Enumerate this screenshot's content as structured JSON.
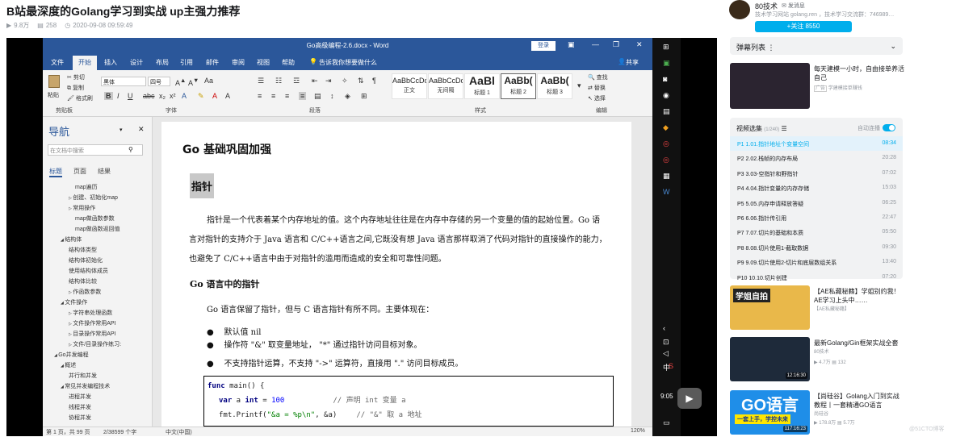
{
  "video": {
    "title": "B站最深度的Golang学习到实战 up主强力推荐",
    "views": "9.8万",
    "danmaku": "258",
    "date": "2020-09-08 09:59:49"
  },
  "word": {
    "window_title": "Go高级编程-2.6.docx - Word",
    "login": "登录",
    "tabs": [
      "文件",
      "开始",
      "插入",
      "设计",
      "布局",
      "引用",
      "邮件",
      "审阅",
      "视图",
      "帮助"
    ],
    "tell_me": "告诉我你想要做什么",
    "share": "共享",
    "ribbon": {
      "paste": "粘贴",
      "cut": "剪切",
      "copy": "复制",
      "format_painter": "格式刷",
      "clipboard": "剪贴板",
      "font_name": "黑体",
      "font_size": "四号",
      "font_group": "字体",
      "paragraph_group": "段落",
      "styles_group": "样式",
      "edit_group": "编辑",
      "find": "查找",
      "replace": "替换",
      "select": "选择",
      "styles": [
        {
          "preview": "AaBbCcDc",
          "name": "正文"
        },
        {
          "preview": "AaBbCcDc",
          "name": "无间隔"
        },
        {
          "preview": "AaBl",
          "name": "标题 1"
        },
        {
          "preview": "AaBb(",
          "name": "标题 2"
        },
        {
          "preview": "AaBb(",
          "name": "标题 3"
        }
      ]
    },
    "nav": {
      "title": "导航",
      "search_placeholder": "在文档中搜索",
      "tabs": [
        "标题",
        "页面",
        "结果"
      ],
      "items": [
        {
          "text": "map遍历",
          "level": 3
        },
        {
          "text": "创建、初始化map",
          "level": 2
        },
        {
          "text": "常用操作",
          "level": 2
        },
        {
          "text": "map做函数参数",
          "level": 3
        },
        {
          "text": "map做函数返回值",
          "level": 3
        },
        {
          "text": "结构体",
          "level": 1
        },
        {
          "text": "结构体类型",
          "level": 2
        },
        {
          "text": "结构体初始化",
          "level": 2
        },
        {
          "text": "使用结构体成员",
          "level": 2
        },
        {
          "text": "结构体比较",
          "level": 2
        },
        {
          "text": "作函数参数",
          "level": 2
        },
        {
          "text": "文件操作",
          "level": 1
        },
        {
          "text": "字符串处理函数",
          "level": 2
        },
        {
          "text": "文件操作常用API",
          "level": 2
        },
        {
          "text": "目录操作常用API",
          "level": 2
        },
        {
          "text": "文件/目录操作练习:",
          "level": 2
        },
        {
          "text": "Go并发编程",
          "level": 0
        },
        {
          "text": "概述",
          "level": 1
        },
        {
          "text": "并行和并发",
          "level": 2
        },
        {
          "text": "常见并发编程技术",
          "level": 1
        },
        {
          "text": "进程并发",
          "level": 2
        },
        {
          "text": "线程并发",
          "level": 2
        },
        {
          "text": "协程并发",
          "level": 2
        }
      ]
    },
    "doc": {
      "h1": "Go 基础巩固加强",
      "h2": "指针",
      "p1": "指针是一个代表着某个内存地址的值。这个内存地址往往是在内存中存储的另一个变量的值的起始位置。Go 语",
      "p2": "言对指针的支持介于 Java 语言和 C/C++语言之间,它既没有想 Java 语言那样取消了代码对指针的直接操作的能力，",
      "p3": "也避免了 C/C++语言中由于对指针的滥用而造成的安全和可靠性问题。",
      "h3": "Go 语言中的指针",
      "p4": "Go 语言保留了指针，但与 C 语言指针有所不同。主要体现在：",
      "bullets": [
        "默认值 nil",
        "操作符 \"&\" 取变量地址， \"*\" 通过指针访问目标对象。",
        "不支持指针运算，不支持 \"->\" 运算符，直接用 \".\" 访问目标成员。"
      ],
      "code": {
        "line1_kw": "func",
        "line1_rest": " main()  {",
        "line2_kw": "var",
        "line2_mid": " a ",
        "line2_type": "int",
        "line2_eq": " = ",
        "line2_num": "100",
        "line2_comment": "// 声明 int 变量 a",
        "line3_fn": "fmt.Printf(",
        "line3_str": "\"&a = %p\\n\"",
        "line3_rest": ", &a)",
        "line3_comment": "// \"&\" 取 a 地址"
      }
    },
    "status": {
      "page": "第 1 页，共 99 页",
      "words": "2/38599 个字",
      "lang": "中文(中国)",
      "zoom": "120%"
    }
  },
  "player": {
    "time": "9:05",
    "right_label": "中"
  },
  "sidebar": {
    "up_name": "80技术",
    "message": "发消息",
    "up_desc": "技术学习网站 golang.ren ，技术学习交流群：746989…",
    "follow": "+关注 8550",
    "danmu_list": "弹幕列表",
    "ad": {
      "title": "每天建模一小时，自由接单养活自己",
      "badge": "广告",
      "sub": "学建模接单赚钱"
    },
    "playlist": {
      "title": "视频选集",
      "count": "(1/240)",
      "autoplay": "自动连播",
      "items": [
        {
          "title": "P1  1.01.指针地址个变量空间",
          "dur": "08:34",
          "active": true
        },
        {
          "title": "P2  2.02.栈帧的内存布局",
          "dur": "20:28"
        },
        {
          "title": "P3  3.03-空指针和野指针",
          "dur": "07:02"
        },
        {
          "title": "P4  4.04.指针变量的内存存储",
          "dur": "15:03"
        },
        {
          "title": "P5  5.05.内存申请释放答疑",
          "dur": "06:25"
        },
        {
          "title": "P6  6.06.指针传引用",
          "dur": "22:47"
        },
        {
          "title": "P7  7.07.切片的基础和本质",
          "dur": "05:50"
        },
        {
          "title": "P8  8.08.切片使用1-截取数据",
          "dur": "09:30"
        },
        {
          "title": "P9  9.09.切片使用2-切片和底层数组关系",
          "dur": "13:40"
        },
        {
          "title": "P10  10.10.切片创建",
          "dur": "07:20"
        }
      ]
    },
    "recs": [
      {
        "title": "【AE私藏秘籍】学姐别约我！AE学习上头中……",
        "up": "【AE私藏秘籍】",
        "views": "",
        "dm": "",
        "dur": "",
        "thumb_text": "学姐自拍"
      },
      {
        "title": "最新Golang/Gin框架实战全套",
        "up": "80技术",
        "views": "4.7万",
        "dm": "132",
        "dur": "12:16:30"
      },
      {
        "title": "【尚硅谷】Golang入门到实战教程丨一套精通GO语言",
        "up": "尚硅谷",
        "views": "178.8万",
        "dm": "5.7万",
        "dur": "117:16:23",
        "thumb_text": "GO语言",
        "thumb_sub": "一套上手，学控未来"
      }
    ],
    "watermark": "@51CTO博客"
  },
  "colors": {
    "word_blue": "#2b579a",
    "bili_blue": "#00aeec"
  }
}
